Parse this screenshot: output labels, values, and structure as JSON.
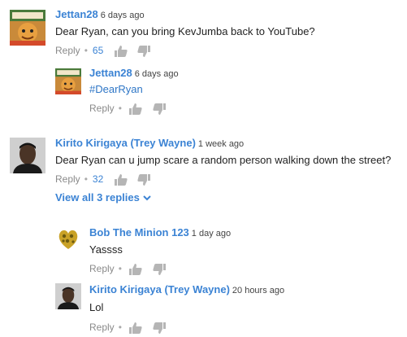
{
  "comments": [
    {
      "author": "Jettan28",
      "time": "6 days ago",
      "text": "Dear Ryan, can you bring KevJumba back to YouTube?",
      "reply_label": "Reply",
      "likes": "65"
    },
    {
      "author": "Jettan28",
      "time": "6 days ago",
      "text": "#DearRyan",
      "reply_label": "Reply"
    },
    {
      "author": "Kirito Kirigaya (Trey Wayne)",
      "time": "1 week ago",
      "text": "Dear Ryan can u jump scare a random person walking down the street?",
      "reply_label": "Reply",
      "likes": "32",
      "view_replies_label": "View all 3 replies"
    },
    {
      "author": "Bob The Minion 123",
      "time": "1 day ago",
      "text": "Yassss",
      "reply_label": "Reply"
    },
    {
      "author": "Kirito Kirigaya (Trey Wayne)",
      "time": "20 hours ago",
      "text": "Lol",
      "reply_label": "Reply"
    }
  ],
  "colors": {
    "author": "#3b83d4",
    "muted": "#8a8a8a",
    "text": "#222222"
  },
  "icons": {
    "like": "thumbs-up-icon",
    "dislike": "thumbs-down-icon",
    "expand": "chevron-down-icon"
  }
}
